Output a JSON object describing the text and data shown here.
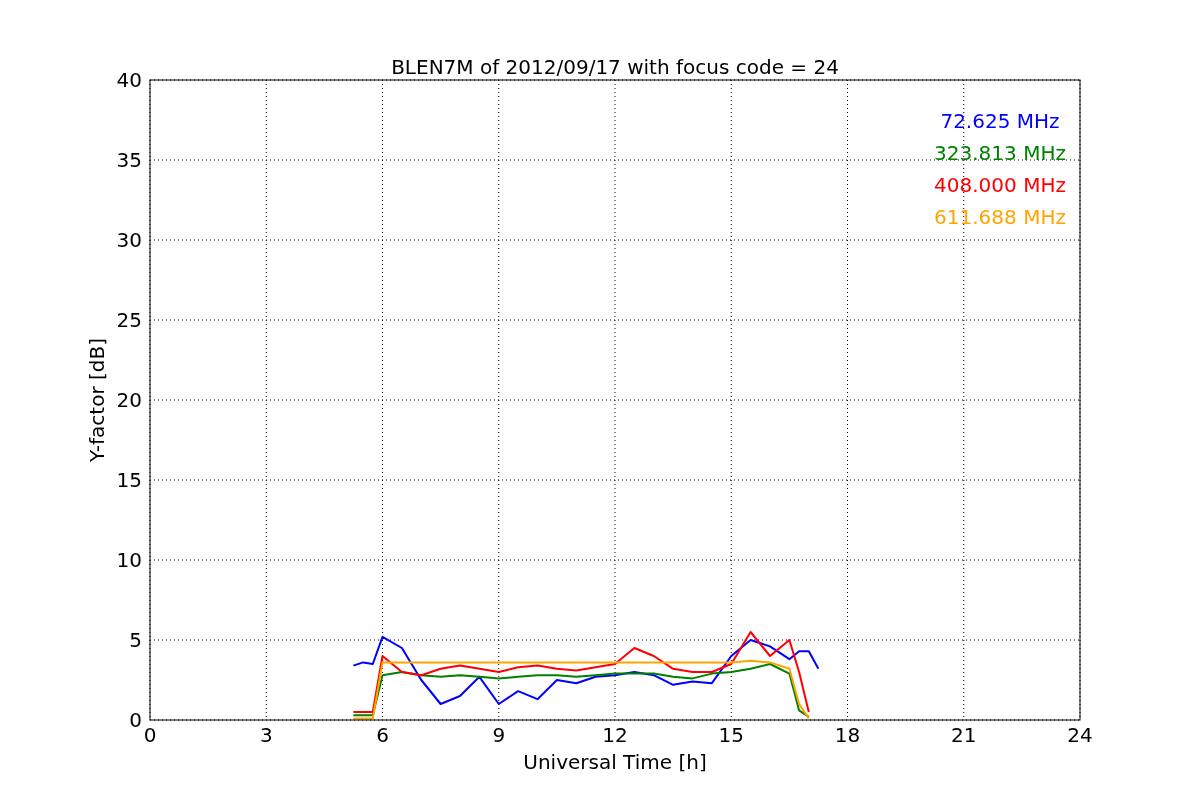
{
  "chart_data": {
    "type": "line",
    "title": "BLEN7M of 2012/09/17 with focus code = 24",
    "xlabel": "Universal Time [h]",
    "ylabel": "Y-factor [dB]",
    "x": [
      5.25,
      5.5,
      5.75,
      6,
      6.5,
      7,
      7.5,
      8,
      8.5,
      9,
      9.5,
      10,
      10.5,
      11,
      11.5,
      12,
      12.5,
      13,
      13.5,
      14,
      14.5,
      15,
      15.5,
      16,
      16.5,
      16.75,
      17,
      17.25
    ],
    "series": [
      {
        "name": "72.625 MHz",
        "color": "#0000ff",
        "values": [
          3.4,
          3.6,
          3.5,
          5.2,
          4.5,
          2.5,
          1.0,
          1.5,
          2.7,
          1.0,
          1.8,
          1.3,
          2.5,
          2.3,
          2.7,
          2.8,
          3.0,
          2.8,
          2.2,
          2.4,
          2.3,
          4.0,
          5.0,
          4.6,
          3.8,
          4.3,
          4.3,
          3.2
        ]
      },
      {
        "name": "323.813 MHz",
        "color": "#008000",
        "values": [
          0.3,
          0.3,
          0.3,
          2.8,
          3.0,
          2.8,
          2.7,
          2.8,
          2.7,
          2.6,
          2.7,
          2.8,
          2.8,
          2.7,
          2.8,
          2.9,
          2.9,
          2.9,
          2.7,
          2.6,
          2.9,
          3.0,
          3.2,
          3.5,
          2.9,
          0.6,
          0.2,
          null
        ]
      },
      {
        "name": "408.000 MHz",
        "color": "#ff0000",
        "values": [
          0.5,
          0.5,
          0.5,
          4.0,
          3.0,
          2.8,
          3.2,
          3.4,
          3.2,
          3.0,
          3.3,
          3.4,
          3.2,
          3.1,
          3.3,
          3.5,
          4.5,
          4.0,
          3.2,
          3.0,
          3.0,
          3.5,
          5.5,
          4.0,
          5.0,
          3.0,
          0.5,
          null
        ]
      },
      {
        "name": "611.688 MHz",
        "color": "#ffa500",
        "values": [
          0.1,
          0.1,
          0.1,
          3.6,
          3.6,
          3.6,
          3.6,
          3.6,
          3.6,
          3.6,
          3.6,
          3.6,
          3.6,
          3.6,
          3.6,
          3.6,
          3.6,
          3.6,
          3.6,
          3.6,
          3.6,
          3.6,
          3.7,
          3.6,
          3.2,
          1.0,
          0.1,
          null
        ]
      }
    ],
    "grid": true,
    "xlim": [
      0,
      24
    ],
    "ylim": [
      0,
      40
    ],
    "xticks": [
      0,
      3,
      6,
      9,
      12,
      15,
      18,
      21,
      24
    ],
    "yticks": [
      0,
      5,
      10,
      15,
      20,
      25,
      30,
      35,
      40
    ]
  }
}
